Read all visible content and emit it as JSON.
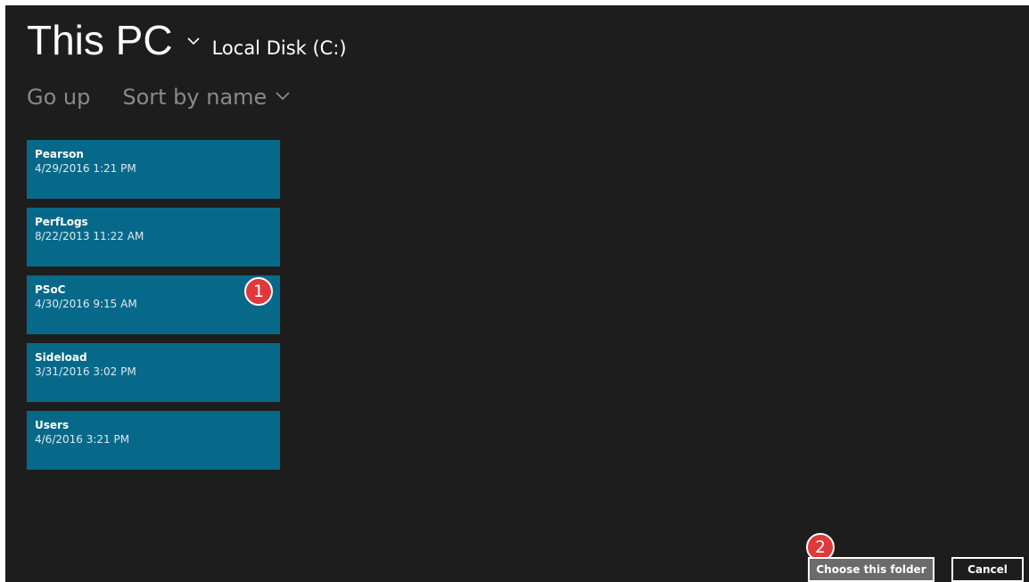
{
  "header": {
    "location": "This PC",
    "sublocation": "Local Disk (C:)"
  },
  "toolbar": {
    "go_up_label": "Go up",
    "sort_label": "Sort by name"
  },
  "folders": [
    {
      "name": "Pearson",
      "date": "4/29/2016 1:21 PM"
    },
    {
      "name": "PerfLogs",
      "date": "8/22/2013 11:22 AM"
    },
    {
      "name": "PSoC",
      "date": "4/30/2016 9:15 AM"
    },
    {
      "name": "Sideload",
      "date": "3/31/2016 3:02 PM"
    },
    {
      "name": "Users",
      "date": "4/6/2016 3:21 PM"
    }
  ],
  "callouts": {
    "first": "1",
    "second": "2"
  },
  "footer": {
    "choose_label": "Choose this folder",
    "cancel_label": "Cancel"
  },
  "colors": {
    "background": "#1d1d1d",
    "tile": "#07698a",
    "callout": "#e0383b",
    "choose_button": "#6b6b6b"
  },
  "icons": {
    "location_dropdown": "chevron-down-icon",
    "sort_dropdown": "chevron-down-icon"
  }
}
